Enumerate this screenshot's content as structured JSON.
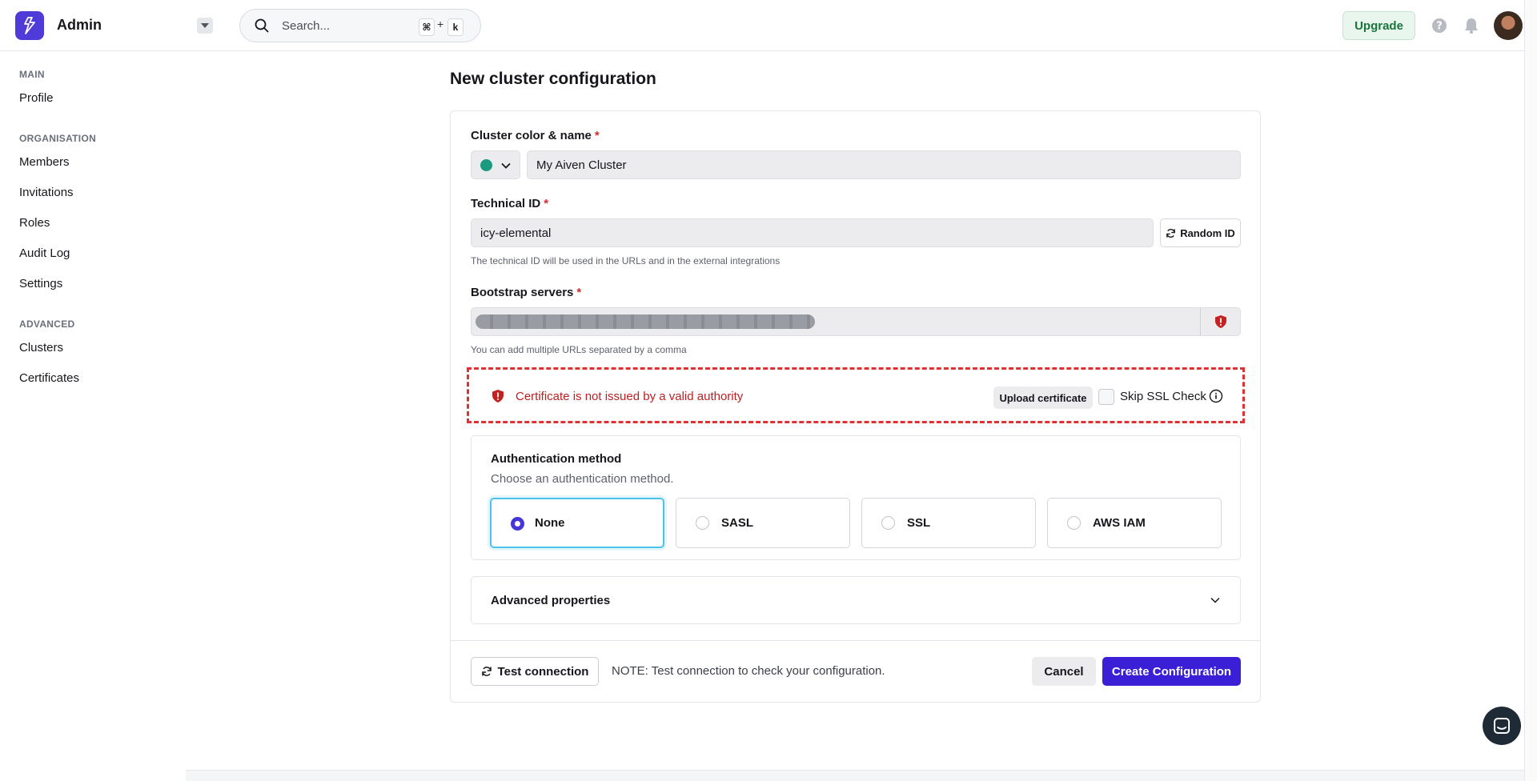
{
  "header": {
    "app_name": "Admin",
    "search_placeholder": "Search...",
    "shortcut_key1": "⌘",
    "shortcut_plus": "+",
    "shortcut_key2": "k",
    "upgrade_label": "Upgrade"
  },
  "sidebar": {
    "sections": [
      {
        "title": "MAIN",
        "items": [
          "Profile"
        ]
      },
      {
        "title": "ORGANISATION",
        "items": [
          "Members",
          "Invitations",
          "Roles",
          "Audit Log",
          "Settings"
        ]
      },
      {
        "title": "ADVANCED",
        "items": [
          "Clusters",
          "Certificates"
        ]
      }
    ]
  },
  "form": {
    "page_title": "New cluster configuration",
    "cluster_name_label": "Cluster color & name",
    "cluster_name_value": "My Aiven Cluster",
    "cluster_color": "#1a9a7e",
    "technical_id_label": "Technical ID",
    "technical_id_value": "icy-elemental",
    "random_id_label": "Random ID",
    "technical_id_hint": "The technical ID will be used in the URLs and in the external integrations",
    "bootstrap_label": "Bootstrap servers",
    "bootstrap_hint": "You can add multiple URLs separated by a comma",
    "required_mark": "*",
    "cert_error": "Certificate is not issued by a valid authority",
    "upload_certificate_label": "Upload certificate",
    "skip_ssl_label": "Skip SSL Check",
    "auth_title": "Authentication method",
    "auth_subtitle": "Choose an authentication method.",
    "auth_options": [
      "None",
      "SASL",
      "SSL",
      "AWS IAM"
    ],
    "auth_selected": "None",
    "advanced_label": "Advanced properties",
    "test_connection_label": "Test connection",
    "note": "NOTE: Test connection to check your configuration.",
    "cancel_label": "Cancel",
    "create_label": "Create Configuration"
  },
  "colors": {
    "accent": "#3a1fd6",
    "error": "#c01f1f",
    "upgrade": "#17753d"
  }
}
